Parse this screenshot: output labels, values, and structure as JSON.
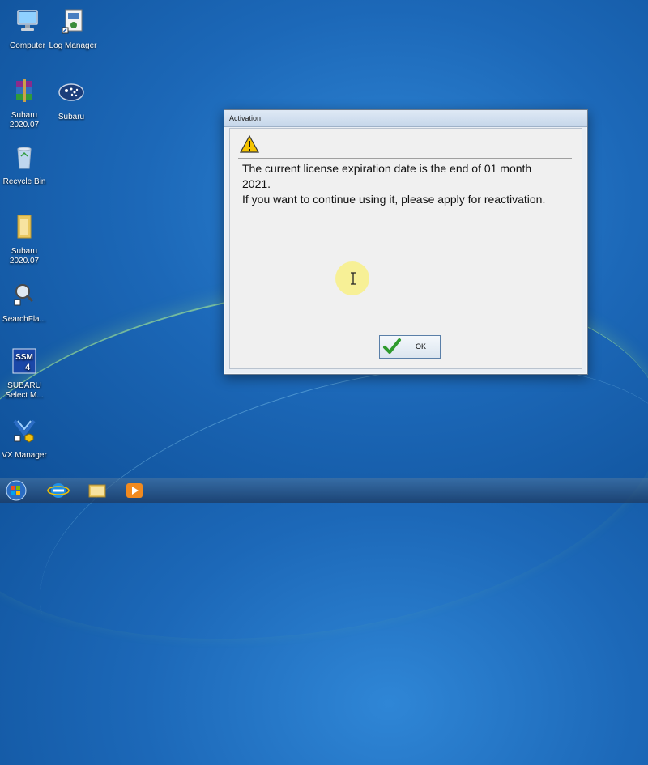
{
  "desktop": {
    "icons": [
      {
        "label": "Computer",
        "glyph": "computer-icon"
      },
      {
        "label": "Log Manager",
        "glyph": "log-manager-icon"
      },
      {
        "label": "Subaru\n2020.07",
        "glyph": "winrar-icon"
      },
      {
        "label": "Subaru",
        "glyph": "subaru-logo-icon"
      },
      {
        "label": "Recycle Bin",
        "glyph": "recycle-bin-icon"
      },
      {
        "label": "Subaru\n2020.07",
        "glyph": "folder-icon"
      },
      {
        "label": "SearchFla...",
        "glyph": "search-tool-icon"
      },
      {
        "label": "SUBARU\nSelect M...",
        "glyph": "ssm4-icon"
      },
      {
        "label": "VX Manager",
        "glyph": "vx-manager-icon"
      }
    ]
  },
  "dialog": {
    "title": "Activation",
    "line1": "The current license expiration date is the end of 01 month",
    "line2": "2021.",
    "line3": "If you want to continue using it, please apply for reactivation.",
    "ok_label": "OK"
  },
  "taskbar": {
    "items": [
      "start-orb-icon",
      "internet-explorer-icon",
      "file-explorer-icon",
      "media-player-icon"
    ]
  },
  "colors": {
    "desktop": "#1c68b8",
    "dialog_bg": "#f0f0f0",
    "warning": "#f5c400",
    "check": "#2e9b2e"
  }
}
